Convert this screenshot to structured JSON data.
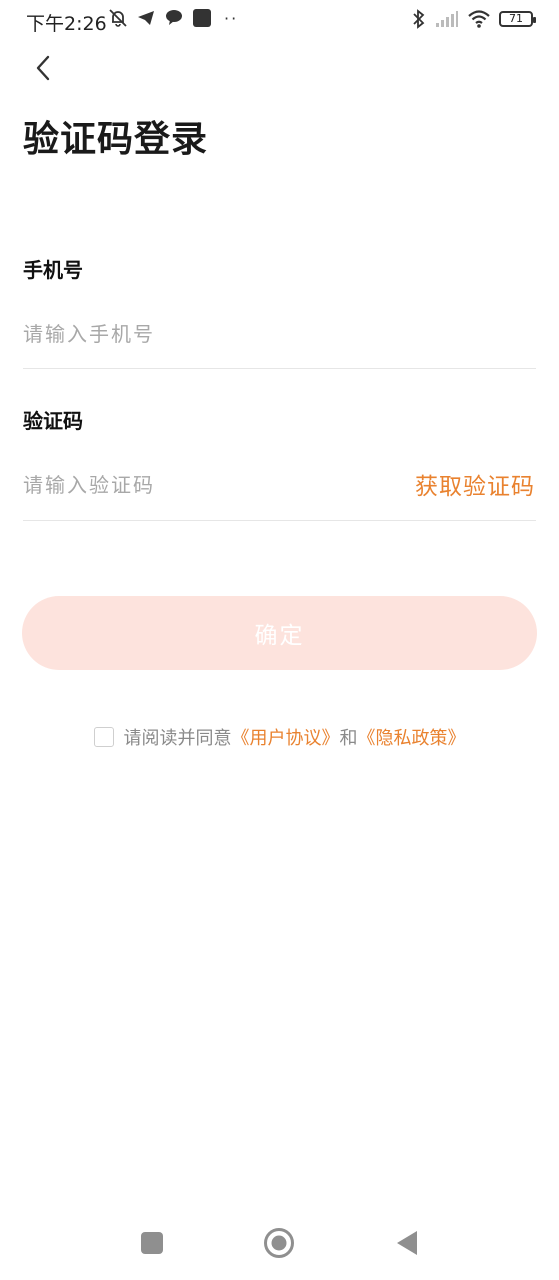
{
  "status_bar": {
    "time": "下午2:26",
    "battery": "71",
    "left_icons": [
      "bell-off-icon",
      "telegram-icon",
      "chat-bubble-icon",
      "app-square-icon"
    ],
    "right_icons": [
      "bluetooth-icon",
      "signal-icon",
      "wifi-icon",
      "battery-icon"
    ],
    "more": "··"
  },
  "header": {
    "back_icon": "chevron-left-icon",
    "title": "验证码登录"
  },
  "form": {
    "phone_label": "手机号",
    "phone_placeholder": "请输入手机号",
    "phone_value": "",
    "code_label": "验证码",
    "code_placeholder": "请输入验证码",
    "code_value": "",
    "get_code_label": "获取验证码",
    "confirm_label": "确定"
  },
  "agreement": {
    "checked": false,
    "prefix": "请阅读并同意",
    "user_agreement": "《用户协议》",
    "and": "和",
    "privacy_policy": "《隐私政策》"
  },
  "nav_bar": {
    "buttons": [
      "recent-apps-icon",
      "home-icon",
      "back-icon"
    ]
  },
  "colors": {
    "accent": "#e9822f",
    "button_disabled_bg": "#fde3dd",
    "divider": "#e6e6e6",
    "placeholder": "#a8a8a8"
  }
}
